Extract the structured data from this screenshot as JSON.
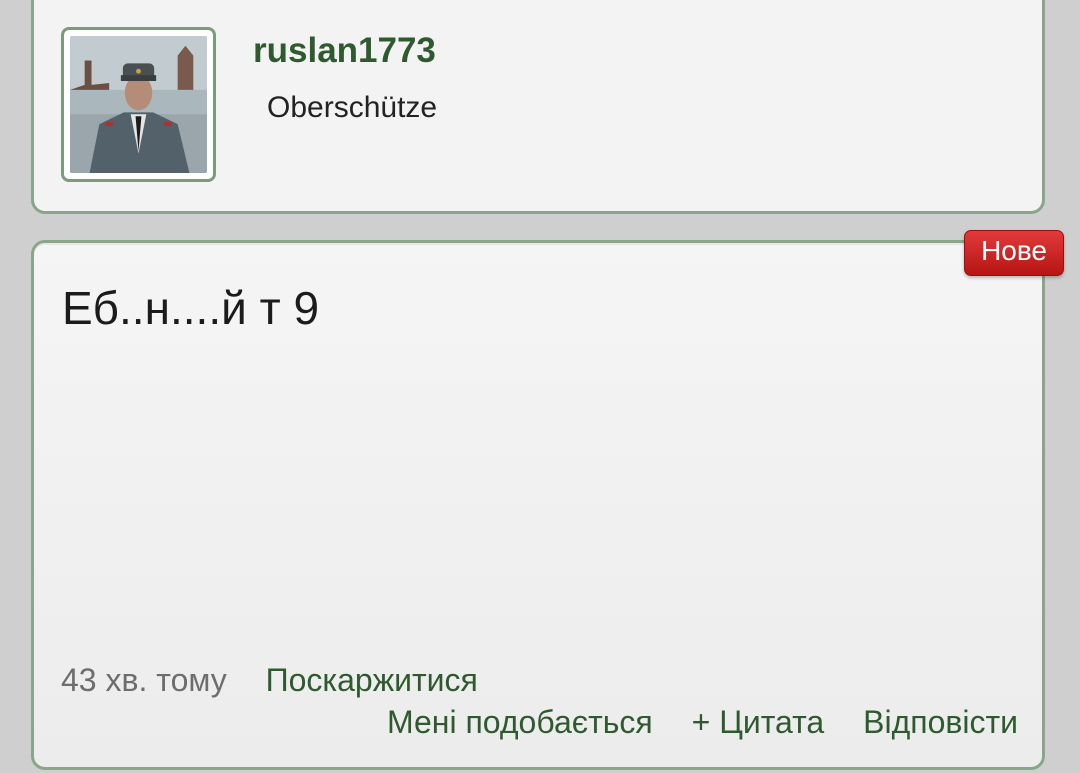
{
  "profile": {
    "username": "ruslan1773",
    "rank": "Oberschütze",
    "avatar_icon": "user-avatar-photo"
  },
  "post": {
    "badge": "Нове",
    "text": "Еб..н....й т 9",
    "timestamp": "43 хв. тому",
    "report_label": "Поскаржитися",
    "like_label": "Мені подобається",
    "quote_label": "+ Цитата",
    "reply_label": "Відповісти"
  },
  "colors": {
    "accent_green": "#2f5a2f",
    "badge_red": "#c41f1f",
    "border_green": "#8aa68a"
  }
}
